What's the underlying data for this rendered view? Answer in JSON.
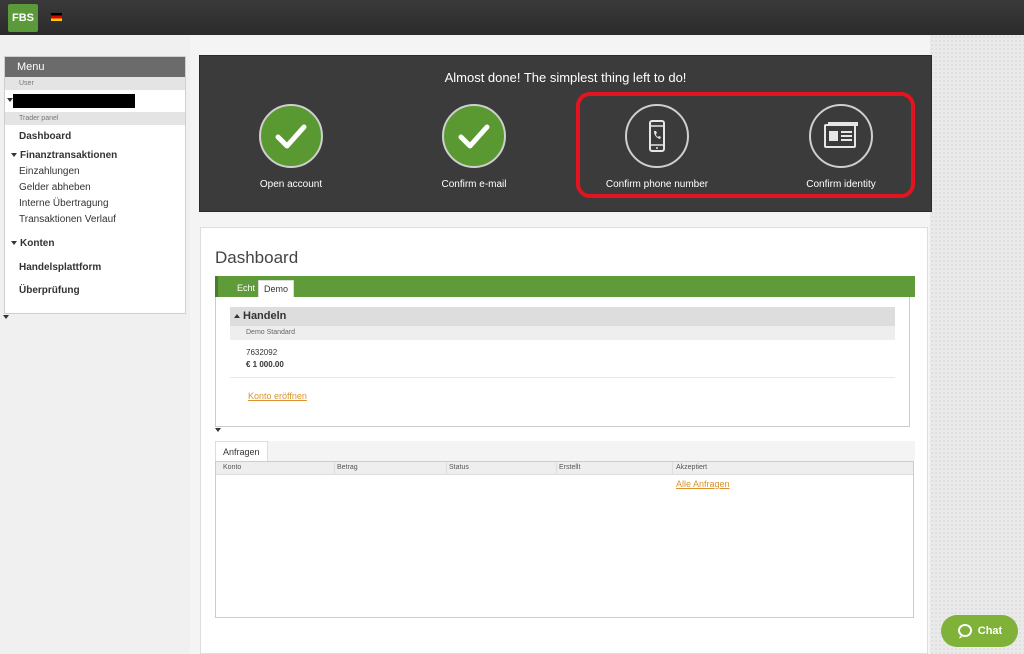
{
  "brand": {
    "logo_text": "FBS",
    "language_flag": "de-flag"
  },
  "menu": {
    "title": "Menu",
    "user_section": "User",
    "trader_section": "Trader panel",
    "dashboard": "Dashboard",
    "finance_group": "Finanztransaktionen",
    "finance_items": [
      "Einzahlungen",
      "Gelder abheben",
      "Interne Übertragung",
      "Transaktionen Verlauf"
    ],
    "accounts_group": "Konten",
    "platform": "Handelsplattform",
    "verification": "Überprüfung"
  },
  "banner": {
    "title": "Almost done! The simplest thing left to do!",
    "steps": [
      {
        "label": "Open account",
        "status": "done",
        "icon": "check-icon"
      },
      {
        "label": "Confirm e-mail",
        "status": "done",
        "icon": "check-icon"
      },
      {
        "label": "Confirm phone number",
        "status": "pending",
        "icon": "phone-icon"
      },
      {
        "label": "Confirm identity",
        "status": "pending",
        "icon": "id-card-icon"
      }
    ],
    "highlight_color": "#e3141f",
    "done_color": "#5a9932"
  },
  "dashboard": {
    "title": "Dashboard",
    "tabs": [
      "Echt",
      "Demo"
    ],
    "active_tab": "Demo",
    "section": "Handeln",
    "section_sub": "Demo Standard",
    "account_number": "7632092",
    "balance": "€ 1 000.00",
    "open_account_link": "Konto eröffnen"
  },
  "requests": {
    "tab": "Anfragen",
    "columns": [
      "Konto",
      "Betrag",
      "Status",
      "Erstellt",
      "Akzeptiert"
    ],
    "all_link": "Alle Anfragen"
  },
  "chat": {
    "label": "Chat"
  }
}
